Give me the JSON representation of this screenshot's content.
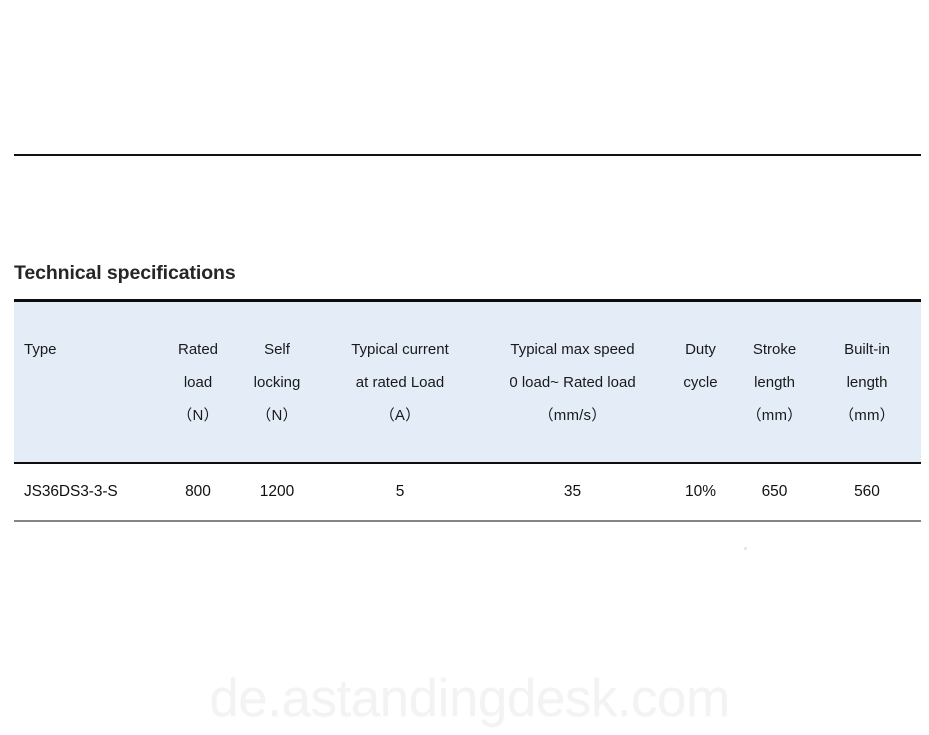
{
  "document": {
    "section_heading": "Technical specifications"
  },
  "table": {
    "columns": [
      {
        "key": "type",
        "line1": "Type",
        "line2": "",
        "unit": ""
      },
      {
        "key": "rated_load",
        "line1": "Rated",
        "line2": "load",
        "unit": "（N）"
      },
      {
        "key": "self_locking",
        "line1": "Self",
        "line2": "locking",
        "unit": "（N）"
      },
      {
        "key": "typical_current",
        "line1": "Typical current",
        "line2": "at rated Load",
        "unit": "（A）"
      },
      {
        "key": "typical_max_speed",
        "line1": "Typical max speed",
        "line2": "0 load~ Rated load",
        "unit": "（mm/s）"
      },
      {
        "key": "duty_cycle",
        "line1": "Duty",
        "line2": "cycle",
        "unit": ""
      },
      {
        "key": "stroke_length",
        "line1": "Stroke",
        "line2": "length",
        "unit": "（mm）"
      },
      {
        "key": "builtin_length",
        "line1": "Built-in",
        "line2": "length",
        "unit": "（mm）"
      }
    ],
    "rows": [
      {
        "type": "JS36DS3-3-S",
        "rated_load": "800",
        "self_locking": "1200",
        "typical_current": "5",
        "typical_max_speed": "35",
        "duty_cycle": "10%",
        "stroke_length": "650",
        "builtin_length": "560"
      }
    ]
  },
  "watermark": {
    "text": "de.astandingdesk.com"
  },
  "colors": {
    "header_band": "#e4edf7",
    "rule_dark": "#0d0d0d",
    "rule_gray": "#858585",
    "heading_text": "#262626",
    "watermark_text": "#f3f3f3"
  }
}
